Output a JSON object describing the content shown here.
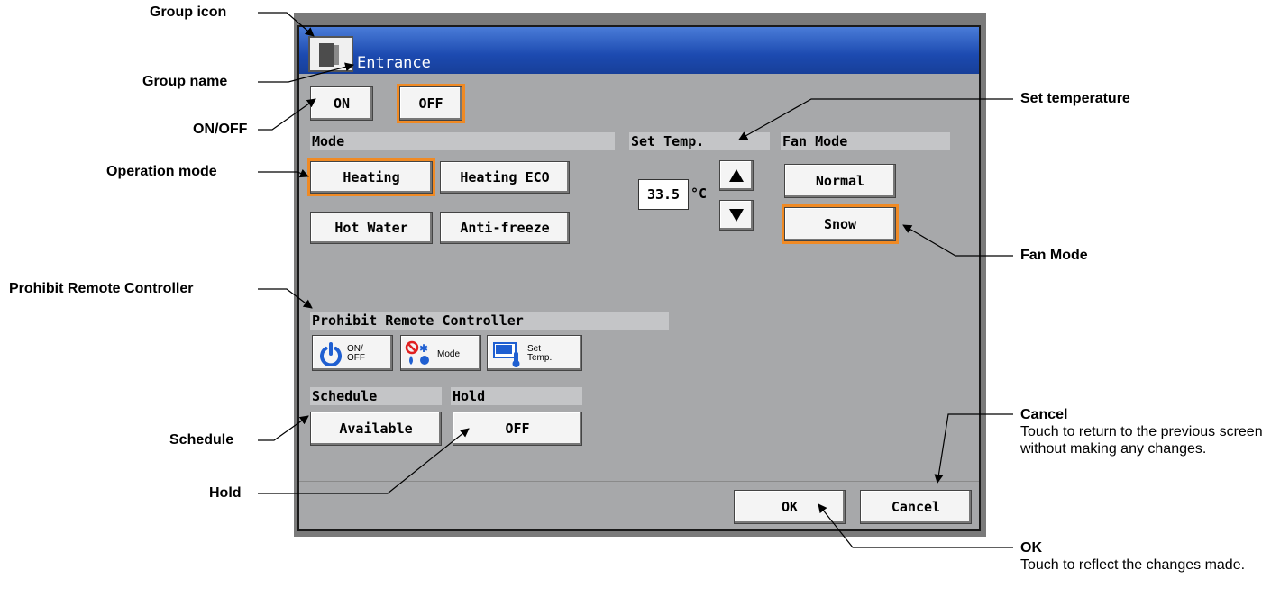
{
  "callouts": {
    "group_icon": "Group icon",
    "group_name": "Group name",
    "on_off": "ON/OFF",
    "operation_mode": "Operation mode",
    "prohibit_remote": "Prohibit Remote Controller",
    "schedule": "Schedule",
    "hold": "Hold",
    "set_temperature": "Set temperature",
    "fan_mode": "Fan Mode",
    "cancel_title": "Cancel",
    "cancel_desc": "Touch to return to the previous screen without making any changes.",
    "ok_title": "OK",
    "ok_desc": "Touch to reflect the changes made."
  },
  "window": {
    "title": "Entrance",
    "icon": "door-icon"
  },
  "power": {
    "on_label": "ON",
    "off_label": "OFF",
    "selected": "OFF"
  },
  "mode": {
    "label": "Mode",
    "options": [
      "Heating",
      "Heating ECO",
      "Hot Water",
      "Anti-freeze"
    ],
    "selected": "Heating"
  },
  "set_temp": {
    "label": "Set Temp.",
    "value": "33.5",
    "unit": "°C",
    "up_icon": "triangle-up-icon",
    "down_icon": "triangle-down-icon"
  },
  "fan_mode": {
    "label": "Fan Mode",
    "options": [
      "Normal",
      "Snow"
    ],
    "selected": "Snow"
  },
  "prohibit": {
    "label": "Prohibit Remote Controller",
    "buttons": [
      {
        "icon": "power-icon",
        "line1": "ON/",
        "line2": "OFF"
      },
      {
        "icon": "prohibit-mode-icon",
        "text": "Mode"
      },
      {
        "icon": "thermometer-display-icon",
        "line1": "Set",
        "line2": "Temp."
      }
    ]
  },
  "schedule": {
    "label": "Schedule",
    "value": "Available"
  },
  "hold": {
    "label": "Hold",
    "value": "OFF"
  },
  "footer": {
    "ok_label": "OK",
    "cancel_label": "Cancel"
  },
  "colors": {
    "title_bar": "#1c4ab0",
    "screen_bg": "#a7a8aa",
    "selected_outline": "#f08a24"
  }
}
